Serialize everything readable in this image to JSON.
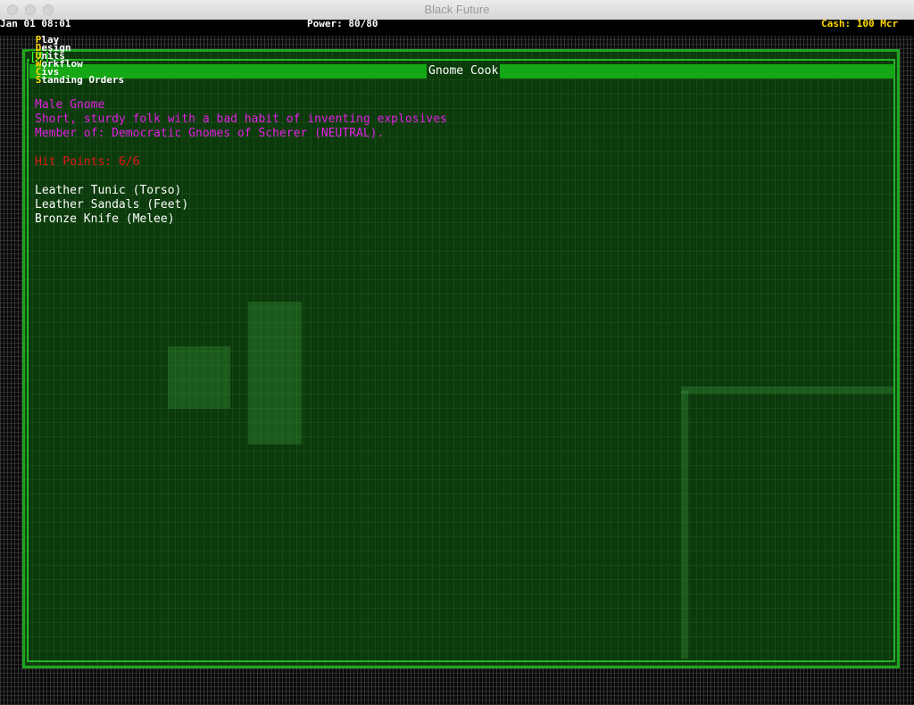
{
  "window": {
    "title": "Black Future"
  },
  "hud": {
    "date": "Jan 01 08:01",
    "power": "Power: 80/80",
    "cash": "Cash: 100 Mcr",
    "menu": [
      {
        "hot": "P",
        "rest": "lay"
      },
      {
        "hot": "D",
        "rest": "esign"
      },
      {
        "hot": "U",
        "rest": "nits"
      },
      {
        "hot": "W",
        "rest": "orkflow"
      },
      {
        "hot": "C",
        "rest": "ivs"
      },
      {
        "hot": "S",
        "rest": "tanding Orders"
      }
    ]
  },
  "dialog": {
    "close_label": "[X]",
    "title": "Gnome Cook",
    "gender_race": "Male Gnome",
    "description": "Short, sturdy folk with a bad habit of inventing explosives",
    "membership": "Member of: Democratic Gnomes of Scherer (NEUTRAL).",
    "hit_points": "Hit Points: 6/6",
    "equipment": [
      "Leather Tunic (Torso)",
      "Leather Sandals (Feet)",
      "Bronze Knife (Melee)"
    ]
  },
  "colors": {
    "dialog_bg": "#0c3a0c",
    "accent_green": "#14a814",
    "magenta": "#e61ee6",
    "red": "#e01818",
    "hotkey_yellow": "#ffd800"
  }
}
